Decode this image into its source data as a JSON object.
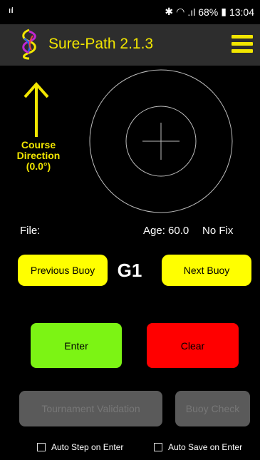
{
  "status_bar": {
    "battery": "68%",
    "time": "13:04"
  },
  "app_bar": {
    "title": "Sure-Path 2.1.3",
    "logo_icon": "sure-path-logo",
    "menu_icon": "hamburger-menu-icon"
  },
  "course": {
    "line1": "Course",
    "line2": "Direction",
    "line3": "(0.0°)",
    "arrow_icon": "up-arrow-icon"
  },
  "info": {
    "file_label": "File:",
    "age_label": "Age: 60.0",
    "fix_label": "No Fix"
  },
  "buoy": {
    "prev_label": "Previous Buoy",
    "current": "G1",
    "next_label": "Next Buoy"
  },
  "actions": {
    "enter_label": "Enter",
    "clear_label": "Clear",
    "tournament_label": "Tournament Validation",
    "buoy_check_label": "Buoy Check"
  },
  "options": {
    "auto_step_label": "Auto Step on Enter",
    "auto_step_checked": false,
    "auto_save_label": "Auto Save on Enter",
    "auto_save_checked": false
  },
  "colors": {
    "accent": "#f2e600",
    "button_yellow": "#ffff00",
    "enter_green": "#7cf414",
    "clear_red": "#ff0000",
    "disabled": "#5a5a5a"
  }
}
